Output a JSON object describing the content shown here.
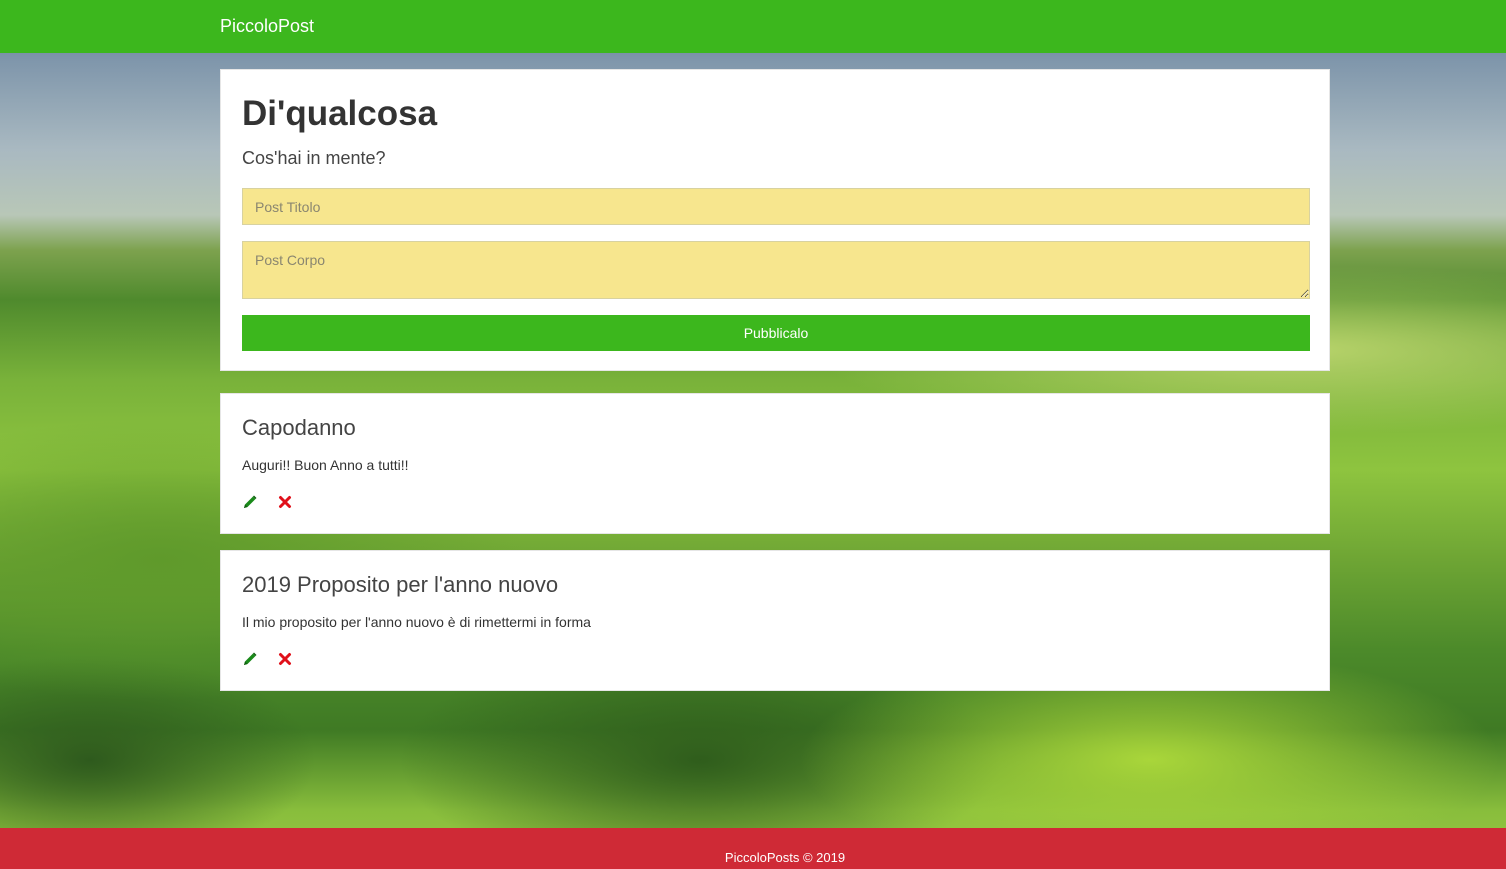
{
  "navbar": {
    "brand": "PiccoloPost",
    "color": "#3cb71d"
  },
  "composer": {
    "heading": "Di'qualcosa",
    "lead": "Cos'hai in mente?",
    "title_placeholder": "Post Titolo",
    "body_placeholder": "Post Corpo",
    "submit_label": "Pubblicalo",
    "field_color": "#f7e68e"
  },
  "posts": [
    {
      "title": "Capodanno",
      "body": "Auguri!! Buon Anno a tutti!!",
      "edit_icon": "pencil-icon",
      "delete_icon": "close-icon"
    },
    {
      "title": "2019 Proposito per l'anno nuovo",
      "body": "Il mio proposito per l'anno nuovo è di rimettermi in forma",
      "edit_icon": "pencil-icon",
      "delete_icon": "close-icon"
    }
  ],
  "footer": {
    "text": "PiccoloPosts © 2019",
    "color": "#cf2a36"
  }
}
